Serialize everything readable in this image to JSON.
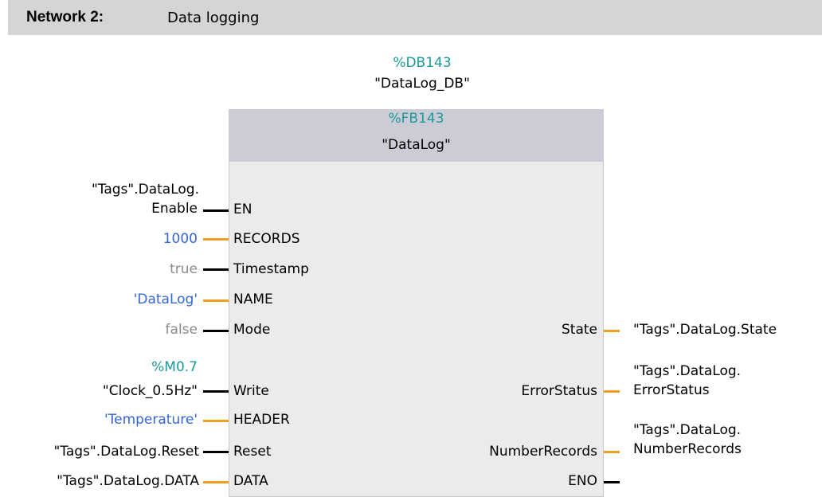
{
  "network": {
    "number": "Network 2:",
    "title": "Data logging"
  },
  "instance": {
    "address": "%DB143",
    "name": "\"DataLog_DB\""
  },
  "block": {
    "address": "%FB143",
    "name": "\"DataLog\""
  },
  "inputs": [
    {
      "pin": "EN",
      "param_lines": [
        "\"Tags\".DataLog.",
        "Enable"
      ],
      "line": "black",
      "color": "black"
    },
    {
      "pin": "RECORDS",
      "param": "1000",
      "line": "orange",
      "color": "blue"
    },
    {
      "pin": "Timestamp",
      "param": "true",
      "line": "black",
      "color": "gray"
    },
    {
      "pin": "NAME",
      "param": "'DataLog'",
      "line": "orange",
      "color": "blue"
    },
    {
      "pin": "Mode",
      "param": "false",
      "line": "black",
      "color": "gray"
    },
    {
      "pin": "Write",
      "param_lines": [
        "%M0.7",
        "\"Clock_0.5Hz\""
      ],
      "line": "black",
      "color": "black"
    },
    {
      "pin": "HEADER",
      "param": "'Temperature'",
      "line": "orange",
      "color": "blue"
    },
    {
      "pin": "Reset",
      "param": "\"Tags\".DataLog.Reset",
      "line": "black",
      "color": "black"
    },
    {
      "pin": "DATA",
      "param": "\"Tags\".DataLog.DATA",
      "line": "orange",
      "color": "black"
    }
  ],
  "outputs": [
    {
      "pin": "State",
      "param_lines": [
        "\"Tags\".DataLog.State"
      ],
      "line": "orange"
    },
    {
      "pin": "ErrorStatus",
      "param_lines": [
        "\"Tags\".DataLog.",
        "ErrorStatus"
      ],
      "line": "orange"
    },
    {
      "pin": "NumberRecords",
      "param_lines": [
        "\"Tags\".DataLog.",
        "NumberRecords"
      ],
      "line": "orange"
    },
    {
      "pin": "ENO",
      "param_lines": [],
      "line": "black"
    }
  ]
}
